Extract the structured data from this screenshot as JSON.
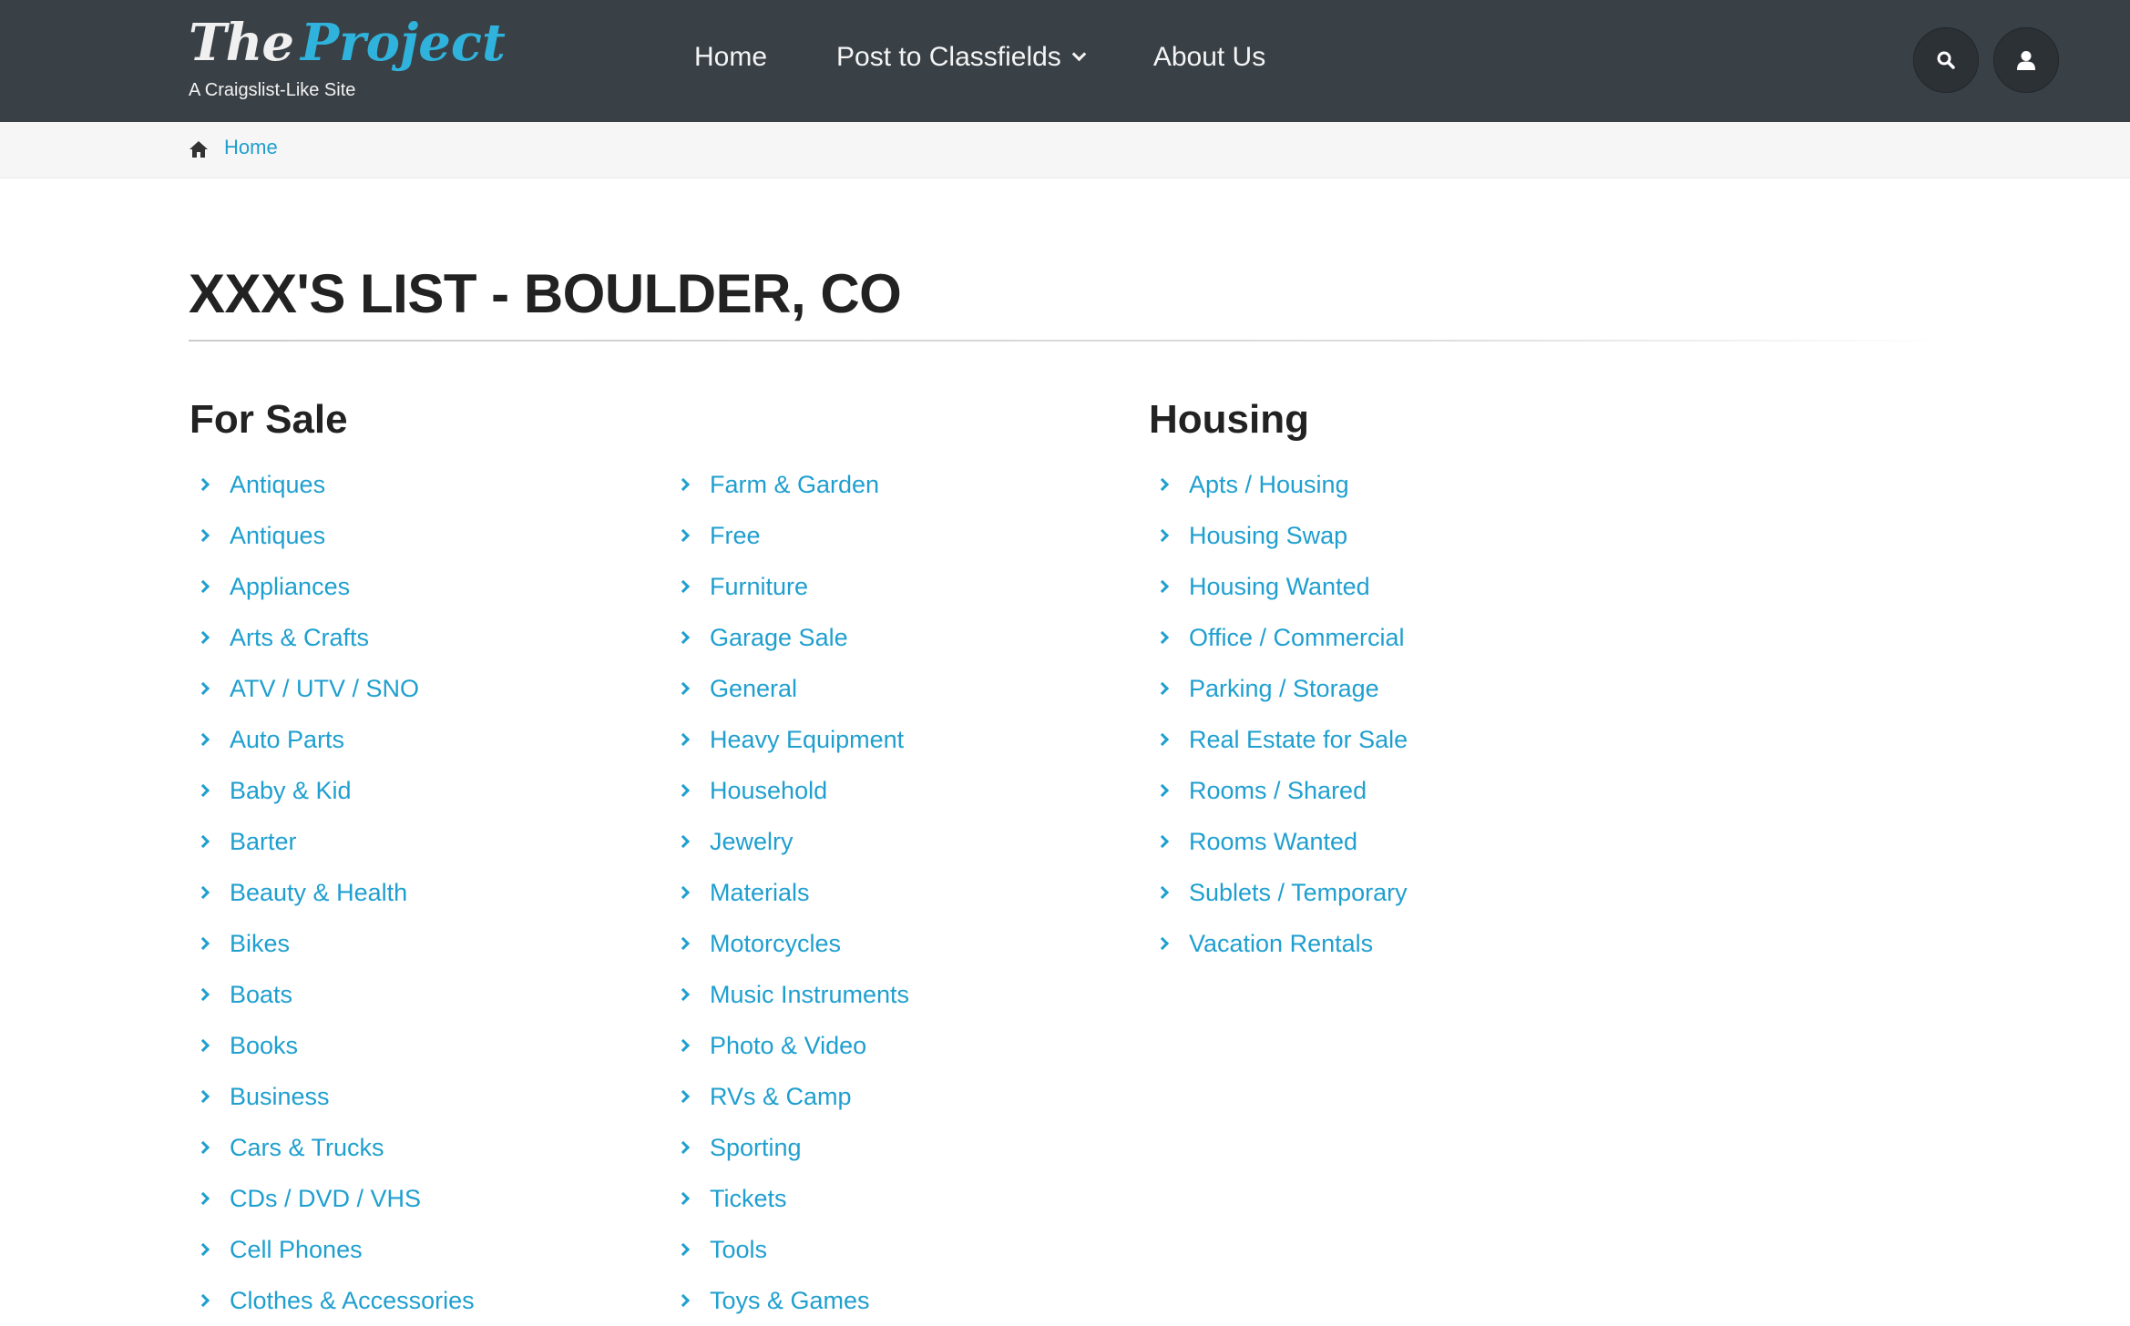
{
  "header": {
    "logo_the": "The",
    "logo_project": "Project",
    "tagline": "A Craigslist-Like Site",
    "nav": [
      {
        "label": "Home"
      },
      {
        "label": "Post to Classfields"
      },
      {
        "label": "About Us"
      }
    ],
    "search_icon": "search-icon",
    "user_icon": "user-icon"
  },
  "breadcrumb": {
    "icon": "home-icon",
    "home_label": "Home"
  },
  "page": {
    "title": "XXX'S LIST - BOULDER, CO"
  },
  "colors": {
    "header_bg": "#394046",
    "link": "#1f9fcf",
    "logo_accent": "#2fb3dc"
  },
  "sections": {
    "for_sale": {
      "heading": "For Sale",
      "col1": [
        "Antiques",
        "Antiques",
        "Appliances",
        "Arts & Crafts",
        "ATV / UTV / SNO",
        "Auto Parts",
        "Baby & Kid",
        "Barter",
        "Beauty & Health",
        "Bikes",
        "Boats",
        "Books",
        "Business",
        "Cars & Trucks",
        "CDs / DVD / VHS",
        "Cell Phones",
        "Clothes & Accessories"
      ],
      "col2": [
        "Farm & Garden",
        "Free",
        "Furniture",
        "Garage Sale",
        "General",
        "Heavy Equipment",
        "Household",
        "Jewelry",
        "Materials",
        "Motorcycles",
        "Music Instruments",
        "Photo & Video",
        "RVs & Camp",
        "Sporting",
        "Tickets",
        "Tools",
        "Toys & Games"
      ]
    },
    "housing": {
      "heading": "Housing",
      "col1": [
        "Apts / Housing",
        "Housing Swap",
        "Housing Wanted",
        "Office / Commercial",
        "Parking / Storage",
        "Real Estate for Sale",
        "Rooms / Shared",
        "Rooms Wanted",
        "Sublets / Temporary",
        "Vacation Rentals"
      ]
    }
  }
}
